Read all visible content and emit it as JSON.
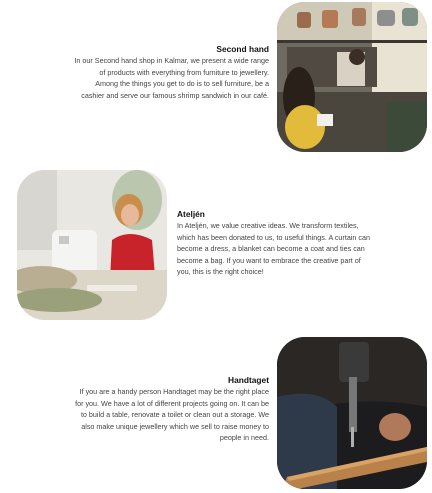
{
  "sections": [
    {
      "title": "Second hand",
      "body": "In our Second hand shop in Kalmar, we present a wide range\nof products with everything from furniture to jewellery.\nAmong the things you get to do is to sell furniture, be a\ncashier and serve our famous shrimp sandwich in our café."
    },
    {
      "title": "Ateljén",
      "body": "In Ateljén, we value creative ideas. We transform textiles,\nwhich has been donated to us, to useful things. A curtain can\nbecome a dress, a blanket can become a coat and ties can\nbecome a bag. If you want to embrace the creative part of\nyou, this is the right choice!"
    },
    {
      "title": "Handtaget",
      "body": "If you are a handy person Handtaget may be the right place\nfor you. We have a lot of different projects going on. It can be\nto build a table, renovate a toilet or clean out a storage. We\nalso make unique jewellery which we sell to raise money to\npeople in need."
    }
  ]
}
